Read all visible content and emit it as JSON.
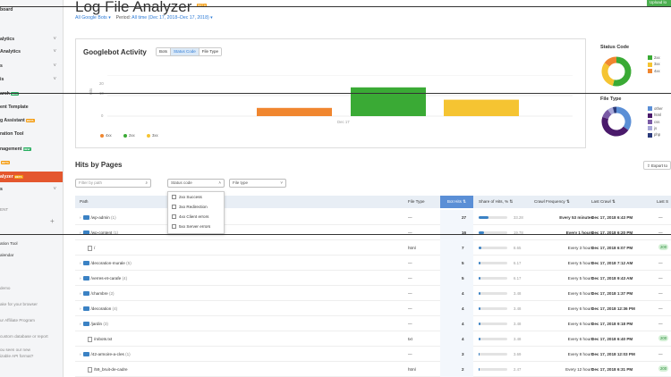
{
  "sidebar": {
    "items": [
      {
        "label": "board",
        "chev": false
      },
      {
        "label": "alytics",
        "chev": true
      },
      {
        "label": "Analytics",
        "chev": true
      },
      {
        "label": "s",
        "chev": true
      },
      {
        "label": "is",
        "chev": true
      },
      {
        "label": "arch",
        "tag": "NEW"
      },
      {
        "label": "ent Template"
      },
      {
        "label": "g Assistant",
        "tag": "BETA"
      },
      {
        "label": "ration Tool"
      },
      {
        "label": "nagement",
        "tag": "NEW"
      },
      {
        "label": "BETA_ONLY"
      },
      {
        "label": "alyzer",
        "tag": "BETA",
        "active": true
      },
      {
        "label": "s",
        "chev": true
      }
    ],
    "section_label": "ENT",
    "plus": "+",
    "tools": [
      "ation Tool",
      "alendar"
    ],
    "footer": [
      "demo",
      "ake for your browser",
      "ur Affiliate Program",
      "custom database or report",
      "ou seen our new",
      "izable API format?"
    ]
  },
  "header": {
    "title": "Log File Analyzer",
    "title_tag": "BETA",
    "upload_label": "Upload lo",
    "filter_bots": "All Google Bots",
    "period_label": "Period:",
    "period_value": "All time (Dec 17, 2018–Dec 17, 2018)"
  },
  "activity": {
    "title": "Googlebot Activity",
    "tabs": [
      "Bots",
      "Status Code",
      "File Type"
    ],
    "active_tab": "Status Code",
    "y_label": "Hits",
    "ticks": [
      "20",
      "10",
      "0"
    ],
    "date_label": "Dec 17",
    "legend": [
      "4xx",
      "2xx",
      "3xx"
    ]
  },
  "chart_data": {
    "type": "bar",
    "categories": [
      "Dec 17"
    ],
    "series": [
      {
        "name": "4xx",
        "values": [
          4
        ],
        "color": "#f0862f"
      },
      {
        "name": "2xx",
        "values": [
          14
        ],
        "color": "#3aaa35"
      },
      {
        "name": "3xx",
        "values": [
          8
        ],
        "color": "#f5c432"
      }
    ],
    "ylim": [
      0,
      20
    ]
  },
  "status_donut": {
    "title": "Status Code",
    "legend": [
      "2xx",
      "3xx",
      "4xx"
    ],
    "colors": [
      "#3aaa35",
      "#f5c432",
      "#f0862f"
    ],
    "values": [
      0.54,
      0.31,
      0.15
    ]
  },
  "file_donut": {
    "title": "File Type",
    "legend": [
      "other",
      "html",
      "css",
      "js",
      "php"
    ],
    "colors": [
      "#5b8fd6",
      "#4a1a6b",
      "#7a5aa5",
      "#a8a8d8",
      "#2a3a7a"
    ],
    "values": [
      0.35,
      0.45,
      0.1,
      0.06,
      0.04
    ]
  },
  "hits": {
    "title": "Hits by Pages",
    "export_label": "Export to",
    "filter_path_placeholder": "Filter by path",
    "status_select": "Status code",
    "file_select": "File type",
    "status_options": [
      "2xx Success",
      "3xx Redirection",
      "4xx Client errors",
      "5xx Server errors"
    ],
    "columns": [
      "Path",
      "File Type",
      "Bot Hits",
      "Share of Hits, %",
      "Crawl Frequency",
      "Last Crawl",
      "Last S"
    ],
    "rows": [
      {
        "kind": "folder",
        "path": "/wp-admin",
        "count": "(1)",
        "type": "—",
        "hits": "27",
        "share": "33.28",
        "share_v": 0.33,
        "freq": "Every 53 minutes",
        "last": "Dec 17, 2018 6:43 PM",
        "status": "—"
      },
      {
        "kind": "folder",
        "path": "/wp-content",
        "count": "(1)",
        "type": "—",
        "hits": "16",
        "share": "19.78",
        "share_v": 0.2,
        "freq": "Every 1 hours",
        "last": "Dec 17, 2018 6:20 PM",
        "status": "—"
      },
      {
        "kind": "file",
        "path": "/",
        "count": "",
        "type": "html",
        "hits": "7",
        "share": "8.65",
        "share_v": 0.09,
        "freq": "Every 3 hours",
        "last": "Dec 17, 2018 6:07 PM",
        "status": "200"
      },
      {
        "kind": "folder",
        "path": "/decoration-murale",
        "count": "(5)",
        "type": "—",
        "hits": "5",
        "share": "6.17",
        "share_v": 0.06,
        "freq": "Every 5 hours",
        "last": "Dec 17, 2018 7:12 AM",
        "status": "—"
      },
      {
        "kind": "folder",
        "path": "/verres-et-carafe",
        "count": "(4)",
        "type": "—",
        "hits": "5",
        "share": "6.17",
        "share_v": 0.06,
        "freq": "Every 5 hours",
        "last": "Dec 17, 2018 9:43 AM",
        "status": "—"
      },
      {
        "kind": "folder",
        "path": "/chambre",
        "count": "(2)",
        "type": "—",
        "hits": "4",
        "share": "3.48",
        "share_v": 0.05,
        "freq": "Every 6 hours",
        "last": "Dec 17, 2018 1:37 PM",
        "status": "—"
      },
      {
        "kind": "folder",
        "path": "/decoration",
        "count": "(4)",
        "type": "—",
        "hits": "4",
        "share": "3.48",
        "share_v": 0.05,
        "freq": "Every 6 hours",
        "last": "Dec 17, 2018 12:36 PM",
        "status": "—"
      },
      {
        "kind": "folder",
        "path": "/jardin",
        "count": "(3)",
        "type": "—",
        "hits": "4",
        "share": "3.48",
        "share_v": 0.05,
        "freq": "Every 6 hours",
        "last": "Dec 17, 2018 9:18 PM",
        "status": "—"
      },
      {
        "kind": "file",
        "path": "/robots.txt",
        "count": "",
        "type": "txt",
        "hits": "4",
        "share": "3.48",
        "share_v": 0.05,
        "freq": "Every 6 hours",
        "last": "Dec 17, 2018 6:40 PM",
        "status": "200"
      },
      {
        "kind": "folder",
        "path": "/42-armoire-a-cles",
        "count": "(1)",
        "type": "—",
        "hits": "3",
        "share": "3.69",
        "share_v": 0.04,
        "freq": "Every 8 hours",
        "last": "Dec 17, 2018 12:03 PM",
        "status": "—"
      },
      {
        "kind": "file",
        "path": "/59_bruit-de-cadre",
        "count": "",
        "type": "html",
        "hits": "2",
        "share": "2.47",
        "share_v": 0.02,
        "freq": "Every 12 hours",
        "last": "Dec 17, 2018 6:31 PM",
        "status": "200"
      }
    ]
  }
}
